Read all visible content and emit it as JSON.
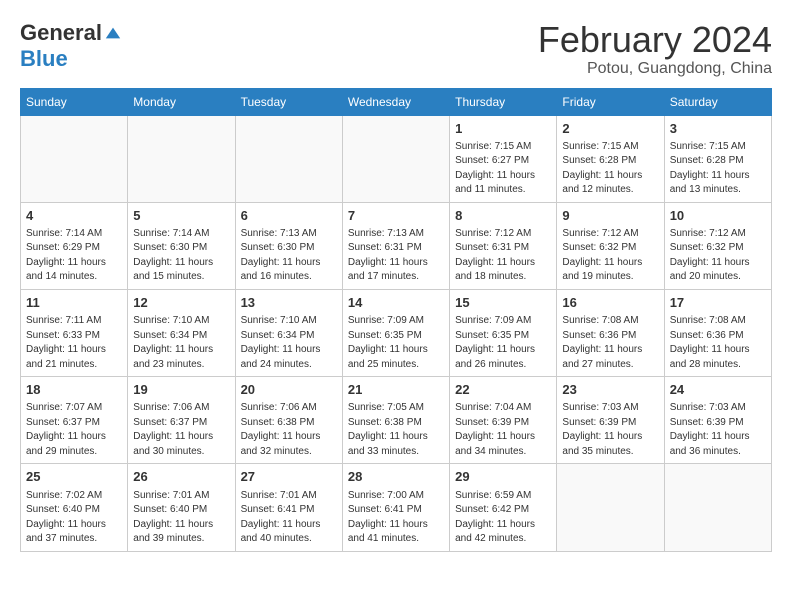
{
  "logo": {
    "general": "General",
    "blue": "Blue"
  },
  "header": {
    "month": "February 2024",
    "location": "Potou, Guangdong, China"
  },
  "weekdays": [
    "Sunday",
    "Monday",
    "Tuesday",
    "Wednesday",
    "Thursday",
    "Friday",
    "Saturday"
  ],
  "weeks": [
    [
      {
        "day": "",
        "sunrise": "",
        "sunset": "",
        "daylight": ""
      },
      {
        "day": "",
        "sunrise": "",
        "sunset": "",
        "daylight": ""
      },
      {
        "day": "",
        "sunrise": "",
        "sunset": "",
        "daylight": ""
      },
      {
        "day": "",
        "sunrise": "",
        "sunset": "",
        "daylight": ""
      },
      {
        "day": "1",
        "sunrise": "Sunrise: 7:15 AM",
        "sunset": "Sunset: 6:27 PM",
        "daylight": "Daylight: 11 hours and 11 minutes."
      },
      {
        "day": "2",
        "sunrise": "Sunrise: 7:15 AM",
        "sunset": "Sunset: 6:28 PM",
        "daylight": "Daylight: 11 hours and 12 minutes."
      },
      {
        "day": "3",
        "sunrise": "Sunrise: 7:15 AM",
        "sunset": "Sunset: 6:28 PM",
        "daylight": "Daylight: 11 hours and 13 minutes."
      }
    ],
    [
      {
        "day": "4",
        "sunrise": "Sunrise: 7:14 AM",
        "sunset": "Sunset: 6:29 PM",
        "daylight": "Daylight: 11 hours and 14 minutes."
      },
      {
        "day": "5",
        "sunrise": "Sunrise: 7:14 AM",
        "sunset": "Sunset: 6:30 PM",
        "daylight": "Daylight: 11 hours and 15 minutes."
      },
      {
        "day": "6",
        "sunrise": "Sunrise: 7:13 AM",
        "sunset": "Sunset: 6:30 PM",
        "daylight": "Daylight: 11 hours and 16 minutes."
      },
      {
        "day": "7",
        "sunrise": "Sunrise: 7:13 AM",
        "sunset": "Sunset: 6:31 PM",
        "daylight": "Daylight: 11 hours and 17 minutes."
      },
      {
        "day": "8",
        "sunrise": "Sunrise: 7:12 AM",
        "sunset": "Sunset: 6:31 PM",
        "daylight": "Daylight: 11 hours and 18 minutes."
      },
      {
        "day": "9",
        "sunrise": "Sunrise: 7:12 AM",
        "sunset": "Sunset: 6:32 PM",
        "daylight": "Daylight: 11 hours and 19 minutes."
      },
      {
        "day": "10",
        "sunrise": "Sunrise: 7:12 AM",
        "sunset": "Sunset: 6:32 PM",
        "daylight": "Daylight: 11 hours and 20 minutes."
      }
    ],
    [
      {
        "day": "11",
        "sunrise": "Sunrise: 7:11 AM",
        "sunset": "Sunset: 6:33 PM",
        "daylight": "Daylight: 11 hours and 21 minutes."
      },
      {
        "day": "12",
        "sunrise": "Sunrise: 7:10 AM",
        "sunset": "Sunset: 6:34 PM",
        "daylight": "Daylight: 11 hours and 23 minutes."
      },
      {
        "day": "13",
        "sunrise": "Sunrise: 7:10 AM",
        "sunset": "Sunset: 6:34 PM",
        "daylight": "Daylight: 11 hours and 24 minutes."
      },
      {
        "day": "14",
        "sunrise": "Sunrise: 7:09 AM",
        "sunset": "Sunset: 6:35 PM",
        "daylight": "Daylight: 11 hours and 25 minutes."
      },
      {
        "day": "15",
        "sunrise": "Sunrise: 7:09 AM",
        "sunset": "Sunset: 6:35 PM",
        "daylight": "Daylight: 11 hours and 26 minutes."
      },
      {
        "day": "16",
        "sunrise": "Sunrise: 7:08 AM",
        "sunset": "Sunset: 6:36 PM",
        "daylight": "Daylight: 11 hours and 27 minutes."
      },
      {
        "day": "17",
        "sunrise": "Sunrise: 7:08 AM",
        "sunset": "Sunset: 6:36 PM",
        "daylight": "Daylight: 11 hours and 28 minutes."
      }
    ],
    [
      {
        "day": "18",
        "sunrise": "Sunrise: 7:07 AM",
        "sunset": "Sunset: 6:37 PM",
        "daylight": "Daylight: 11 hours and 29 minutes."
      },
      {
        "day": "19",
        "sunrise": "Sunrise: 7:06 AM",
        "sunset": "Sunset: 6:37 PM",
        "daylight": "Daylight: 11 hours and 30 minutes."
      },
      {
        "day": "20",
        "sunrise": "Sunrise: 7:06 AM",
        "sunset": "Sunset: 6:38 PM",
        "daylight": "Daylight: 11 hours and 32 minutes."
      },
      {
        "day": "21",
        "sunrise": "Sunrise: 7:05 AM",
        "sunset": "Sunset: 6:38 PM",
        "daylight": "Daylight: 11 hours and 33 minutes."
      },
      {
        "day": "22",
        "sunrise": "Sunrise: 7:04 AM",
        "sunset": "Sunset: 6:39 PM",
        "daylight": "Daylight: 11 hours and 34 minutes."
      },
      {
        "day": "23",
        "sunrise": "Sunrise: 7:03 AM",
        "sunset": "Sunset: 6:39 PM",
        "daylight": "Daylight: 11 hours and 35 minutes."
      },
      {
        "day": "24",
        "sunrise": "Sunrise: 7:03 AM",
        "sunset": "Sunset: 6:39 PM",
        "daylight": "Daylight: 11 hours and 36 minutes."
      }
    ],
    [
      {
        "day": "25",
        "sunrise": "Sunrise: 7:02 AM",
        "sunset": "Sunset: 6:40 PM",
        "daylight": "Daylight: 11 hours and 37 minutes."
      },
      {
        "day": "26",
        "sunrise": "Sunrise: 7:01 AM",
        "sunset": "Sunset: 6:40 PM",
        "daylight": "Daylight: 11 hours and 39 minutes."
      },
      {
        "day": "27",
        "sunrise": "Sunrise: 7:01 AM",
        "sunset": "Sunset: 6:41 PM",
        "daylight": "Daylight: 11 hours and 40 minutes."
      },
      {
        "day": "28",
        "sunrise": "Sunrise: 7:00 AM",
        "sunset": "Sunset: 6:41 PM",
        "daylight": "Daylight: 11 hours and 41 minutes."
      },
      {
        "day": "29",
        "sunrise": "Sunrise: 6:59 AM",
        "sunset": "Sunset: 6:42 PM",
        "daylight": "Daylight: 11 hours and 42 minutes."
      },
      {
        "day": "",
        "sunrise": "",
        "sunset": "",
        "daylight": ""
      },
      {
        "day": "",
        "sunrise": "",
        "sunset": "",
        "daylight": ""
      }
    ]
  ]
}
